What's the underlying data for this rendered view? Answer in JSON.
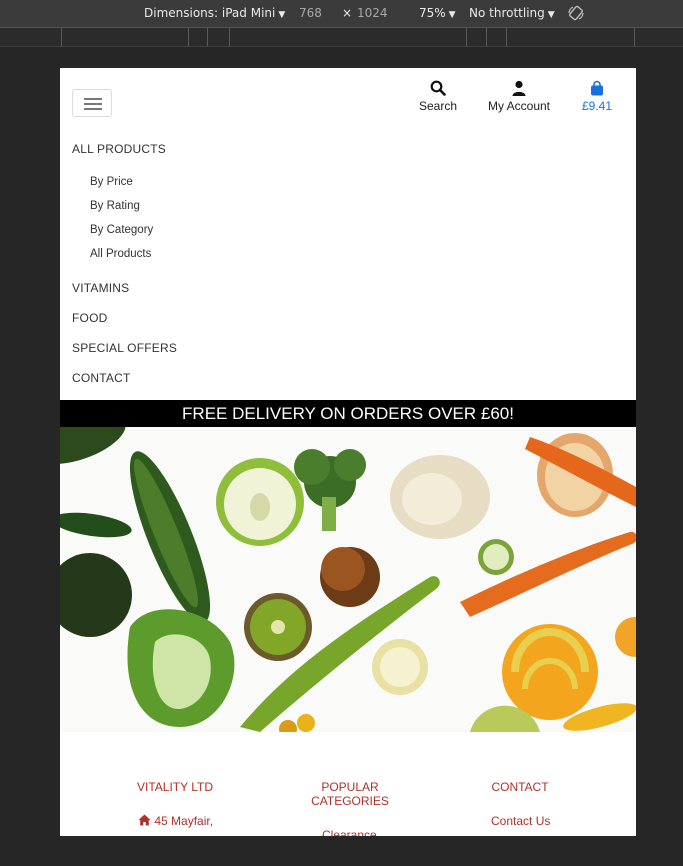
{
  "devtools": {
    "device_label": "Dimensions: iPad Mini",
    "width": "768",
    "times": "×",
    "height": "1024",
    "zoom": "75%",
    "throttling": "No throttling",
    "caret": "▼"
  },
  "header": {
    "search_label": "Search",
    "account_label": "My Account",
    "cart_total": "£9.41"
  },
  "nav": {
    "all_products": "ALL PRODUCTS",
    "sub_items": [
      "By Price",
      "By Rating",
      "By Category",
      "All Products"
    ],
    "vitamins": "VITAMINS",
    "food": "FOOD",
    "special_offers": "SPECIAL OFFERS",
    "contact": "CONTACT"
  },
  "banner": {
    "text": "FREE DELIVERY ON ORDERS OVER £60!"
  },
  "footer": {
    "col1_title": "VITALITY LTD",
    "col1_address": "45 Mayfair,",
    "col2_title_line1": "POPULAR",
    "col2_title_line2": "CATEGORIES",
    "col2_link": "Clearance",
    "col3_title": "CONTACT",
    "col3_link": "Contact Us"
  },
  "colors": {
    "accent_blue": "#1a6fe0",
    "footer_red": "#b0302a"
  }
}
